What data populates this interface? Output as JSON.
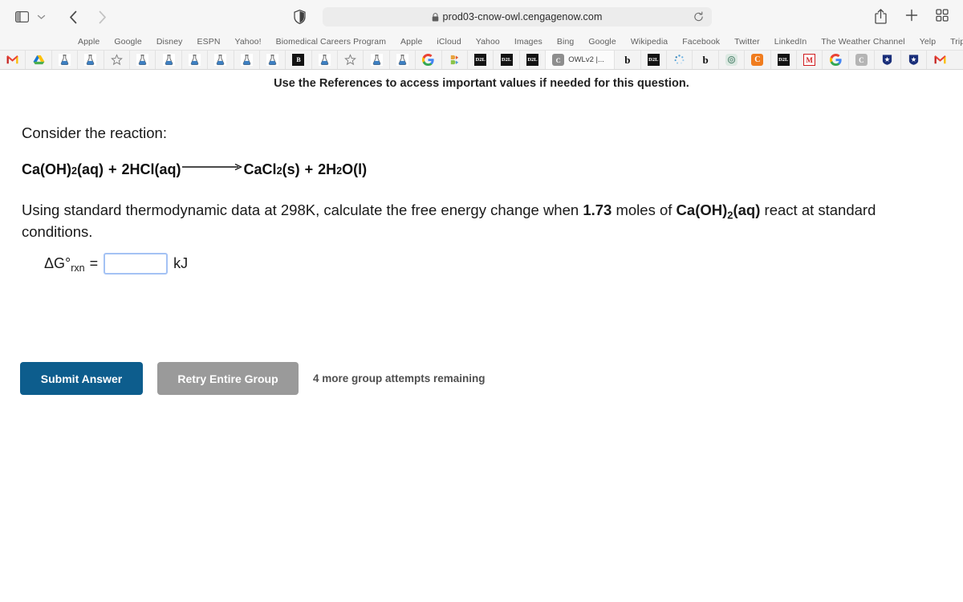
{
  "browser": {
    "url": "prod03-cnow-owl.cengagenow.com",
    "icons": {
      "sidebar": "sidebar-toggle-icon",
      "chevron": "chevron-down-icon",
      "back": "back-arrow-icon",
      "forward": "forward-arrow-icon",
      "shield": "privacy-shield-icon",
      "lock": "lock-icon",
      "reload": "reload-icon",
      "share": "share-icon",
      "newtab": "plus-icon",
      "tab_overview": "tab-overview-icon",
      "apps_grid": "apps-grid-icon"
    },
    "bookmarks": [
      "Apple",
      "Google",
      "Disney",
      "ESPN",
      "Yahoo!",
      "Biomedical Careers Program",
      "Apple",
      "iCloud",
      "Yahoo",
      "Images",
      "Bing",
      "Google",
      "Wikipedia",
      "Facebook",
      "Twitter",
      "LinkedIn",
      "The Weather Channel",
      "Yelp",
      "TripAdvisor"
    ],
    "favicons": [
      {
        "name": "gmail-icon",
        "kind": "gmail"
      },
      {
        "name": "google-drive-icon",
        "kind": "drive"
      },
      {
        "name": "owl-flask-icon",
        "kind": "flask"
      },
      {
        "name": "owl-flask-icon",
        "kind": "flask"
      },
      {
        "name": "star-icon",
        "kind": "star"
      },
      {
        "name": "owl-flask-icon",
        "kind": "flask"
      },
      {
        "name": "owl-flask-icon",
        "kind": "flask"
      },
      {
        "name": "owl-flask-icon",
        "kind": "flask"
      },
      {
        "name": "owl-flask-icon",
        "kind": "flask"
      },
      {
        "name": "owl-flask-icon",
        "kind": "flask"
      },
      {
        "name": "owl-flask-icon",
        "kind": "flask"
      },
      {
        "name": "blackboard-icon",
        "kind": "sq-dark",
        "text": "B"
      },
      {
        "name": "owl-flask-icon",
        "kind": "flask"
      },
      {
        "name": "star-icon",
        "kind": "star"
      },
      {
        "name": "owl-flask-icon",
        "kind": "flask"
      },
      {
        "name": "owl-flask-icon",
        "kind": "flask"
      },
      {
        "name": "google-icon",
        "kind": "google"
      },
      {
        "name": "brightspace-icon",
        "kind": "brightspace"
      },
      {
        "name": "d2l-icon",
        "kind": "sq-dark",
        "text": "D2L"
      },
      {
        "name": "d2l-icon",
        "kind": "sq-dark",
        "text": "D2L"
      },
      {
        "name": "d2l-icon",
        "kind": "sq-dark",
        "text": "D2L"
      }
    ],
    "active_tab": {
      "label": "OWLv2 |...",
      "icon": "cengage-c-icon"
    },
    "favicons_right": [
      {
        "name": "bold-b-icon",
        "kind": "letter-b"
      },
      {
        "name": "d2l-icon",
        "kind": "sq-dark",
        "text": "D2L"
      },
      {
        "name": "loading-spinner-icon",
        "kind": "spinner"
      },
      {
        "name": "bold-b-icon",
        "kind": "letter-b"
      },
      {
        "name": "openai-icon",
        "kind": "openai"
      },
      {
        "name": "cengage-c-icon",
        "kind": "c-orange"
      },
      {
        "name": "d2l-icon",
        "kind": "sq-dark",
        "text": "D2L"
      },
      {
        "name": "merriam-webster-icon",
        "kind": "m-red"
      },
      {
        "name": "google-icon",
        "kind": "google"
      },
      {
        "name": "cengage-gray-c-icon",
        "kind": "c-gray"
      },
      {
        "name": "shield-star-icon",
        "kind": "shield-star"
      },
      {
        "name": "shield-star-icon",
        "kind": "shield-star"
      },
      {
        "name": "gmail-icon",
        "kind": "gmail"
      }
    ]
  },
  "page": {
    "reference_banner": "Use the References to access important values if needed for this question.",
    "consider_label": "Consider the reaction:",
    "equation": {
      "reactant1": "Ca(OH)",
      "reactant1_sub": "2",
      "reactant1_state": "(aq)",
      "plus1": "+",
      "reactant2": "2HCl(aq)",
      "product1": "CaCl",
      "product1_sub": "2",
      "product1_state": "(s)",
      "plus2": "+",
      "product2": "2H",
      "product2_sub": "2",
      "product2_rest": "O(l)"
    },
    "question": {
      "part1": "Using standard thermodynamic data at 298K, calculate the free energy change when ",
      "moles": "1.73",
      "part2": " moles of ",
      "compound": "Ca(OH)",
      "compound_sub": "2",
      "compound_state": "(aq)",
      "part3": " react at standard conditions."
    },
    "answer": {
      "symbol": "ΔG°",
      "subscript": "rxn",
      "equals": "=",
      "value": "",
      "placeholder": "",
      "unit": "kJ"
    },
    "buttons": {
      "submit": "Submit Answer",
      "retry": "Retry Entire Group"
    },
    "attempts_text": "4 more group attempts remaining"
  },
  "colors": {
    "submit_blue": "#0d5d8d",
    "retry_gray": "#9a9a9a",
    "input_focus": "#a4c2f4",
    "chrome_bg": "#f6f6f6"
  }
}
